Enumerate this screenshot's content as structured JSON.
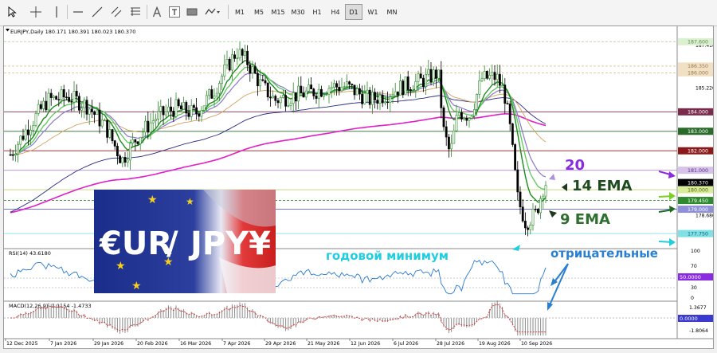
{
  "toolbar": {
    "timeframes": [
      "M1",
      "M5",
      "M15",
      "M30",
      "H1",
      "H4",
      "D1",
      "W1",
      "MN"
    ],
    "active_timeframe": "D1",
    "text_tool_label": "A",
    "label_tool_label": "T"
  },
  "chart": {
    "header": "EURJPY,Daily  180.171 180.391 180.023 180.370",
    "current_price": "180.370",
    "price_scale": [
      "187.410",
      "186.350",
      "186.000",
      "185.220",
      "184.000",
      "183.000",
      "182.000",
      "181.000",
      "180.000",
      "179.450",
      "179.000",
      "178.680",
      "177.750"
    ],
    "price_tags": [
      {
        "label": "187.600",
        "color": "#dbefd1",
        "text": "#5a8a4a"
      },
      {
        "label": "186.350",
        "color": "#f2e0c4",
        "text": "#9a7a4a"
      },
      {
        "label": "186.000",
        "color": "#f2e0c4",
        "text": "#9a7a4a"
      },
      {
        "label": "184.000",
        "color": "#7a2a4a",
        "text": "#ffffff"
      },
      {
        "label": "183.000",
        "color": "#2a6a2a",
        "text": "#ffffff"
      },
      {
        "label": "182.000",
        "color": "#8a1a1a",
        "text": "#ffffff"
      },
      {
        "label": "181.000",
        "color": "#d7c2ec",
        "text": "#553377"
      },
      {
        "label": "180.370",
        "color": "#000000",
        "text": "#ffffff"
      },
      {
        "label": "180.000",
        "color": "#d9ec9a",
        "text": "#556611"
      },
      {
        "label": "179.450",
        "color": "#2e8a2e",
        "text": "#ffffff"
      },
      {
        "label": "179.000",
        "color": "#9090d8",
        "text": "#ffffff"
      },
      {
        "label": "177.750",
        "color": "#7fe0e6",
        "text": "#116677"
      }
    ],
    "date_labels": [
      "12 Dec 2025",
      "7 Jan 2026",
      "29 Jan 2026",
      "20 Feb 2026",
      "16 Mar 2026",
      "7 Apr 2026",
      "29 Apr 2026",
      "21 May 2026",
      "12 Jun 2026",
      "6 Jul 2026",
      "28 Jul 2026",
      "19 Aug 2026",
      "10 Sep 2026"
    ],
    "annotations": {
      "ema20": "20",
      "ema14": "14 EMA",
      "ema9": "9 EMA",
      "yearly_low": "годовой минимум",
      "negative": "отрицательные"
    },
    "logo": {
      "left": "€UR",
      "right": "JPY¥"
    }
  },
  "rsi": {
    "title": "RSI(14) 43.6180",
    "scale": [
      "100",
      "70",
      "50.0000",
      "30",
      "0"
    ],
    "tag": "50.0000"
  },
  "macd": {
    "title": "MACD(12,26,9) -1.1154 -1.4733",
    "scale": [
      "1.3677",
      "0.0000",
      "-1.8064"
    ],
    "tag": "0.0000"
  },
  "colors": {
    "bull_candle": "#2b8a2b",
    "bear_candle": "#000000",
    "ema9": "#1d8a1d",
    "ema14": "#5cc85c",
    "ema20": "#8c7ac8",
    "ema50": "#d4a060",
    "ema100": "#2a2a80",
    "ema200": "#e020c8",
    "annotation_cyan": "#22cde0",
    "annotation_purple": "#8a2be2",
    "annotation_green": "#1e5e1e"
  }
}
